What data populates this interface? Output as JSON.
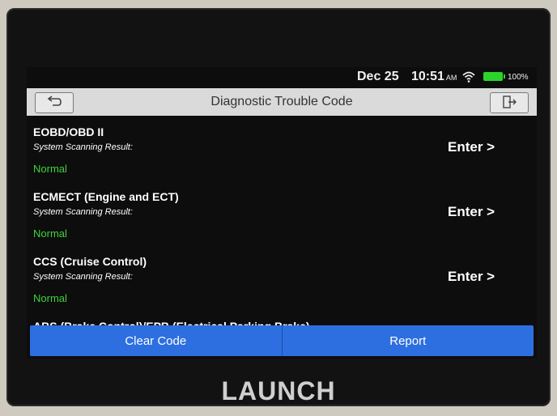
{
  "brand": "LAUNCH",
  "status": {
    "date": "Dec 25",
    "time": "10:51",
    "ampm": "AM",
    "battery": "100%",
    "battery_color": "#2bd42b"
  },
  "header": {
    "title": "Diagnostic Trouble Code",
    "back_icon": "back-arrow-icon",
    "exit_icon": "exit-icon"
  },
  "systems": [
    {
      "name": "EOBD/OBD II",
      "subtitle": "System Scanning Result:",
      "status": "Normal",
      "action": "Enter >"
    },
    {
      "name": "ECMECT (Engine and ECT)",
      "subtitle": "System Scanning Result:",
      "status": "Normal",
      "action": "Enter >"
    },
    {
      "name": "CCS (Cruise Control)",
      "subtitle": "System Scanning Result:",
      "status": "Normal",
      "action": "Enter >"
    }
  ],
  "partial_item": "ABS (Brake Control)/EPB (Electrical Parking Brake)",
  "footer": {
    "clear_label": "Clear Code",
    "report_label": "Report",
    "accent": "#2d6fe0"
  },
  "colors": {
    "status_normal": "#3fd23f",
    "titlebar": "#dadada"
  }
}
